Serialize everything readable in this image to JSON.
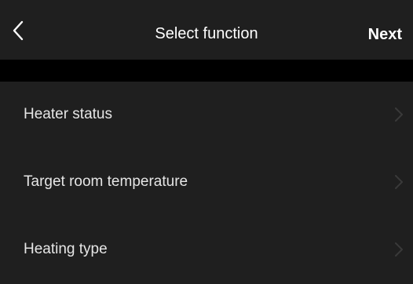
{
  "header": {
    "back_icon": "chevron-left-icon",
    "title": "Select function",
    "next_label": "Next"
  },
  "functions": [
    {
      "label": "Heater status",
      "icon": "chevron-right-icon"
    },
    {
      "label": "Target room temperature",
      "icon": "chevron-right-icon"
    },
    {
      "label": "Heating type",
      "icon": "chevron-right-icon"
    }
  ],
  "colors": {
    "background": "#000000",
    "surface": "#1f1f1f",
    "text_primary": "#ffffff",
    "text_row": "#e6e6e6",
    "chevron": "#3a3a3a"
  }
}
